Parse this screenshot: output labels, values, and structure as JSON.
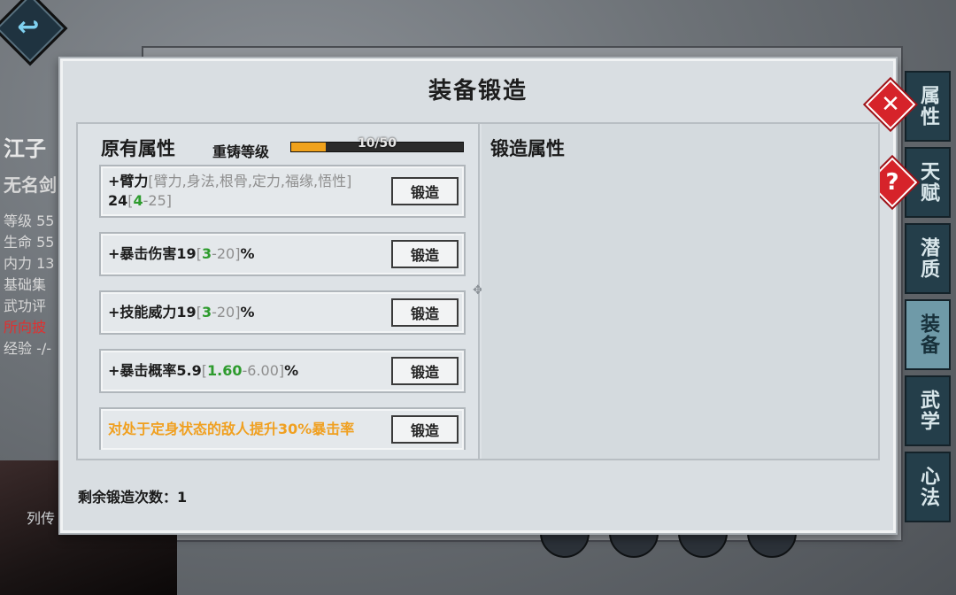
{
  "background": {
    "back_button_icon": "back-arrow-icon",
    "character": {
      "name": "江子",
      "title": "无名剑",
      "stats": [
        "等级 55",
        "生命 55",
        "内力 13",
        "基础集",
        "武功评",
        "所向披",
        "经验 -/-"
      ]
    },
    "biography_label": "列传",
    "side_tabs": [
      {
        "label": "属性",
        "active": false
      },
      {
        "label": "天赋",
        "active": false
      },
      {
        "label": "潜质",
        "active": false
      },
      {
        "label": "装备",
        "active": true
      },
      {
        "label": "武学",
        "active": false
      },
      {
        "label": "心法",
        "active": false
      }
    ]
  },
  "dialog": {
    "title": "装备锻造",
    "close_icon": "close-icon",
    "help_icon": "help-icon",
    "help_symbol": "?",
    "close_symbol": "✕",
    "original_title": "原有属性",
    "forge_title": "锻造属性",
    "recast": {
      "label": "重铸等级",
      "text": "10/50",
      "current": 10,
      "max": 50
    },
    "attributes": [
      {
        "prefix": "+臂力",
        "options": "[臂力,身法,根骨,定力,福缘,悟性]",
        "value": "24",
        "range_open": "[",
        "range_min": "4",
        "range_max": "-25]",
        "suffix": "",
        "button": "锻造"
      },
      {
        "prefix": "+暴击伤害19",
        "range_open": "[",
        "range_min": "3",
        "range_max": "-20]",
        "suffix": "%",
        "button": "锻造"
      },
      {
        "prefix": "+技能威力19",
        "range_open": "[",
        "range_min": "3",
        "range_max": "-20]",
        "suffix": "%",
        "button": "锻造"
      },
      {
        "prefix": "+暴击概率5.9",
        "range_open": "[",
        "range_min": "1.60",
        "range_max": "-6.00]",
        "suffix": "%",
        "button": "锻造"
      },
      {
        "special": "对处于定身状态的敌人提升30%暴击率",
        "button": "锻造"
      }
    ],
    "remaining_label": "剩余锻造次数：",
    "remaining_count": "1"
  },
  "colors": {
    "accent_green": "#2d9b2d",
    "accent_orange": "#f0a020",
    "close_red": "#d6232a",
    "progress_fill": "#f0a21c"
  }
}
